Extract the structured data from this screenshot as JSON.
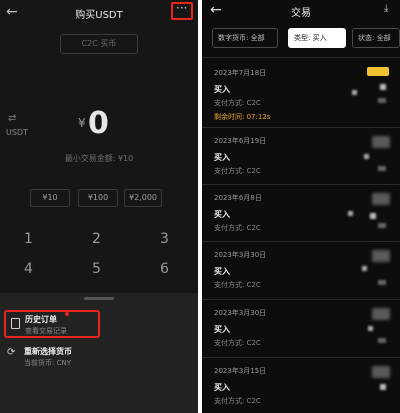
{
  "left_panel": {
    "header": {
      "title": "购买USDT",
      "more_label": "···"
    },
    "c2c_label": "C2C 买币",
    "unit_label": "USDT",
    "currency_sign": "¥",
    "amount": "0",
    "min_trade": "最小交易金额: ¥10",
    "presets": [
      "¥10",
      "¥100",
      "¥2,000"
    ],
    "keypad": [
      "1",
      "2",
      "3",
      "4",
      "5",
      "6"
    ],
    "sheet": {
      "history_title": "历史订单",
      "history_sub": "查看交易记录",
      "reselect_title": "重新选择货币",
      "reselect_sub": "当前货币: CNY"
    }
  },
  "right_panel": {
    "header": {
      "title": "交易"
    },
    "filters": [
      {
        "label": "数字货币: 全部",
        "active": false
      },
      {
        "label": "类型: 买入",
        "active": true
      },
      {
        "label": "状态: 全部",
        "active": false
      }
    ],
    "orders": [
      {
        "date": "2023年7月18日",
        "type": "买入",
        "pay": "支付方式: C2C",
        "timer": "剩余时间: 07:12s"
      },
      {
        "date": "2023年6月19日",
        "type": "买入",
        "pay": "支付方式: C2C"
      },
      {
        "date": "2023年6月8日",
        "type": "买入",
        "pay": "支付方式: C2C"
      },
      {
        "date": "2023年3月30日",
        "type": "买入",
        "pay": "支付方式: C2C"
      },
      {
        "date": "2023年3月30日",
        "type": "买入",
        "pay": "支付方式: C2C"
      },
      {
        "date": "2023年3月15日",
        "type": "买入",
        "pay": "支付方式: C2C"
      }
    ]
  },
  "colors": {
    "highlight": "#e8261d",
    "badge": "#f2c230",
    "timer": "#e8a52b"
  }
}
